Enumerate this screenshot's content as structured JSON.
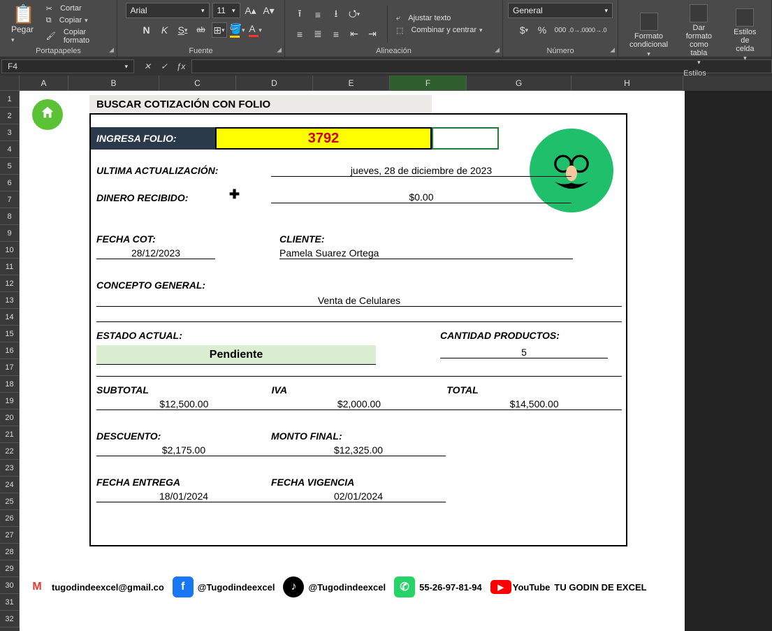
{
  "ribbon": {
    "clipboard": {
      "label": "Portapapeles",
      "paste": "Pegar",
      "cut": "Cortar",
      "copy": "Copiar ",
      "format_painter": "Copiar formato"
    },
    "font": {
      "label": "Fuente",
      "name": "Arial",
      "size": "11",
      "bold": "N",
      "italic": "K",
      "underline": "S",
      "strike": "ab"
    },
    "alignment": {
      "label": "Alineación",
      "wrap": "Ajustar texto",
      "merge": "Combinar y centrar"
    },
    "number": {
      "label": "Número",
      "format": "General",
      "currency": "$",
      "percent": "%",
      "thousands": "000",
      "inc_dec": ".00",
      "dec_dec": ".0"
    },
    "styles": {
      "label": "Estilos",
      "cond": "Formato\ncondicional",
      "table": "Dar formato\ncomo tabla",
      "cell": "Estilos de\ncelda"
    }
  },
  "namebox": "F4",
  "columns": [
    "A",
    "B",
    "C",
    "D",
    "E",
    "F",
    "G",
    "H"
  ],
  "rows": [
    "1",
    "2",
    "3",
    "4",
    "5",
    "6",
    "7",
    "8",
    "9",
    "10",
    "11",
    "12",
    "13",
    "14",
    "15",
    "16",
    "17",
    "18",
    "19",
    "20",
    "21",
    "22",
    "23",
    "24",
    "25",
    "26",
    "27",
    "28",
    "29",
    "30",
    "31",
    "32"
  ],
  "form": {
    "title": "BUSCAR COTIZACIÓN CON FOLIO",
    "folio_label": "INGRESA FOLIO:",
    "folio_value": "3792",
    "last_update_label": "ULTIMA ACTUALIZACIÓN:",
    "last_update_value": "jueves, 28 de diciembre de 2023",
    "money_label": "DINERO RECIBIDO:",
    "money_value": "$0.00",
    "date_label": "FECHA COT:",
    "date_value": "28/12/2023",
    "client_label": "CLIENTE:",
    "client_value": "Pamela Suarez Ortega",
    "concept_label": "CONCEPTO GENERAL:",
    "concept_value": "Venta de Celulares",
    "status_label": "ESTADO ACTUAL:",
    "status_value": "Pendiente",
    "qty_label": "CANTIDAD PRODUCTOS:",
    "qty_value": "5",
    "subtotal_label": "SUBTOTAL",
    "subtotal_value": "$12,500.00",
    "iva_label": "IVA",
    "iva_value": "$2,000.00",
    "total_label": "TOTAL",
    "total_value": "$14,500.00",
    "discount_label": "DESCUENTO:",
    "discount_value": "$2,175.00",
    "final_label": "MONTO FINAL:",
    "final_value": "$12,325.00",
    "deliv_label": "FECHA ENTREGA",
    "deliv_value": "18/01/2024",
    "valid_label": "FECHA VIGENCIA",
    "valid_value": "02/01/2024"
  },
  "social": {
    "gmail": "tugodindeexcel@gmail.co",
    "fb": "@Tugodindeexcel",
    "tk": "@Tugodindeexcel",
    "wa": "55-26-97-81-94",
    "yt": "YouTube",
    "yt_name": "TU GODIN DE EXCEL"
  }
}
